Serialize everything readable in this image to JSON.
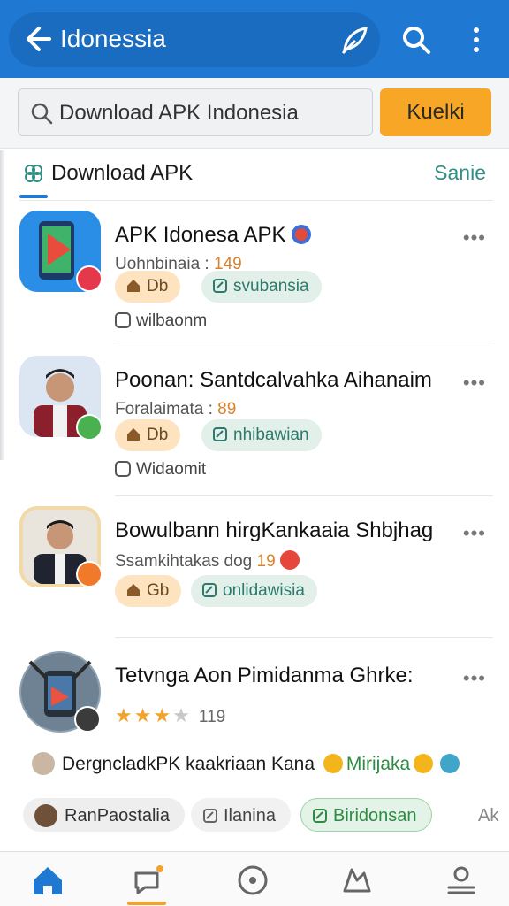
{
  "appbar": {
    "title": "Idonessia",
    "icons": [
      "back-arrow-icon",
      "leaf-icon",
      "search-icon",
      "more-vertical-icon"
    ]
  },
  "search": {
    "value": "Download APK Indonesia",
    "button_label": "Kuelki"
  },
  "section": {
    "title": "Download APK",
    "see_all": "Sanie"
  },
  "items": [
    {
      "name": "APK Idonesa APK",
      "sub_text": "Uohnbinaia : ",
      "sub_num": "149",
      "tag1": "Db",
      "tag2": "svubansia",
      "meta": "wilbaonm"
    },
    {
      "name": "Poonan: Santdcalvahka Aihanaim",
      "sub_text": "Foralaimata : ",
      "sub_num": "89",
      "tag1": "Db",
      "tag2": "nhibawian",
      "meta": "Widaomit"
    },
    {
      "name": "Bowulbann hirgKankaaia Shbjhag",
      "sub_text": "Ssamkihtakas dog  ",
      "sub_num": "19",
      "tag1": "Gb",
      "tag2": "onlidawisia"
    },
    {
      "name": "Tetvnga Aon Pimidanma Ghrke:",
      "rating_count": "119",
      "stars": 3
    }
  ],
  "promo": {
    "text_a": "DergncladkPK kaakriaan Kana",
    "highlight": "Mirijaka"
  },
  "chips": [
    "RanPaostalia",
    "Ilanina",
    "Biridonsan",
    "Ak"
  ],
  "colors": {
    "appbar": "#1f78d1",
    "accent_orange": "#f7a626",
    "accent_green": "#2f8f84"
  }
}
